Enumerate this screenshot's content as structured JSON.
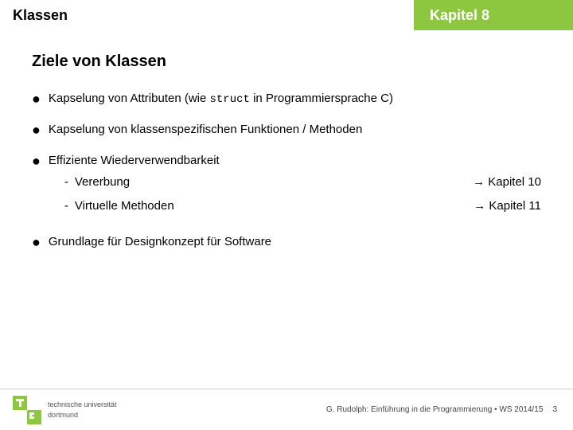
{
  "header": {
    "left_label": "Klassen",
    "right_label": "Kapitel 8"
  },
  "main": {
    "title": "Ziele von Klassen",
    "bullets": [
      {
        "id": "b1",
        "text_before": "Kapselung von Attributen (wie ",
        "code": "struct",
        "text_after": " in Programmiersprache C)"
      },
      {
        "id": "b2",
        "text": "Kapselung von klassenspezifischen Funktionen / Methoden"
      },
      {
        "id": "b3",
        "text": "Effiziente Wiederverwendbarkeit",
        "subitems": [
          {
            "label": "Vererbung",
            "arrow": "→ Kapitel 10"
          },
          {
            "label": "Virtuelle Methoden",
            "arrow": "→ Kapitel 11"
          }
        ]
      },
      {
        "id": "b4",
        "text": "Grundlage für Designkonzept für Software"
      }
    ]
  },
  "footer": {
    "university_line1": "technische universität",
    "university_line2": "dortmund",
    "citation": "G. Rudolph: Einführung in die Programmierung • WS 2014/15",
    "page": "3"
  }
}
